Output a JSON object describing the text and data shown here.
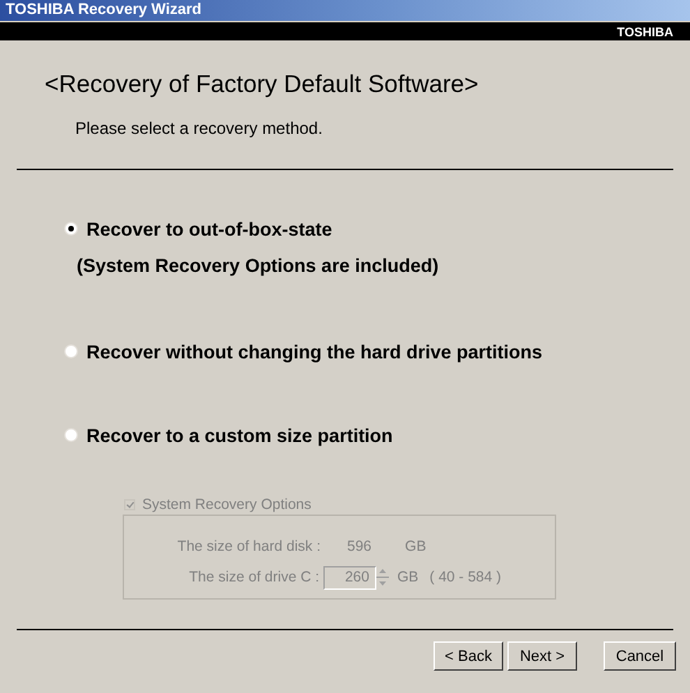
{
  "window": {
    "title": "TOSHIBA Recovery Wizard"
  },
  "brand_bar": {
    "text": "TOSHIBA"
  },
  "heading": "<Recovery of Factory Default Software>",
  "instruction": "Please select a recovery method.",
  "options": [
    {
      "label": "Recover to out-of-box-state",
      "selected": true,
      "note": "(System Recovery Options are included)"
    },
    {
      "label": "Recover without changing the hard drive partitions",
      "selected": false
    },
    {
      "label": "Recover to a custom size partition",
      "selected": false
    }
  ],
  "custom_group": {
    "disabled": true,
    "checkbox": {
      "label": "System Recovery Options",
      "checked": true
    },
    "hard_disk": {
      "label": "The size of hard disk :",
      "value": "596",
      "unit": "GB"
    },
    "drive_c": {
      "label": "The size of drive C :",
      "value": "260",
      "unit": "GB",
      "range": "( 40 - 584 )"
    }
  },
  "buttons": [
    {
      "label": "< Back"
    },
    {
      "label": "Next >"
    },
    {
      "label": "Cancel"
    }
  ]
}
